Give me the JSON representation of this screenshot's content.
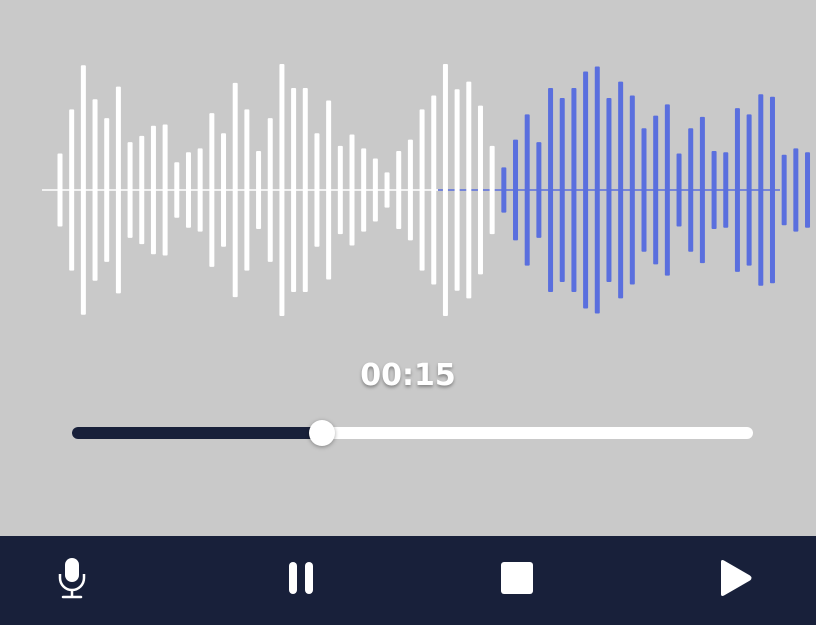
{
  "player": {
    "elapsed": "00:15",
    "progress": 0.367
  },
  "waveform": {
    "played_color": "#ffffff",
    "unplayed_color": "#5a6fde",
    "baseline_color": "#ffffff",
    "bars": [
      0.29,
      0.64,
      0.99,
      0.72,
      0.57,
      0.82,
      0.38,
      0.43,
      0.51,
      0.52,
      0.22,
      0.3,
      0.33,
      0.61,
      0.45,
      0.85,
      0.64,
      0.31,
      0.57,
      1.0,
      0.81,
      0.81,
      0.45,
      0.71,
      0.35,
      0.44,
      0.33,
      0.25,
      0.14,
      0.31,
      0.4,
      0.64,
      0.75,
      1.0,
      0.8,
      0.86,
      0.67,
      0.35,
      0.18,
      0.4,
      0.6,
      0.38,
      0.81,
      0.73,
      0.81,
      0.94,
      0.98,
      0.73,
      0.86,
      0.75,
      0.49,
      0.59,
      0.68,
      0.29,
      0.49,
      0.58,
      0.31,
      0.3,
      0.65,
      0.6,
      0.76,
      0.74,
      0.28,
      0.33,
      0.3,
      0.21,
      0.33,
      0.44,
      0.45,
      0.29
    ]
  },
  "toolbar": {
    "color": "#18203a",
    "icons": [
      "microphone-icon",
      "pause-icon",
      "stop-icon",
      "play-icon"
    ]
  }
}
